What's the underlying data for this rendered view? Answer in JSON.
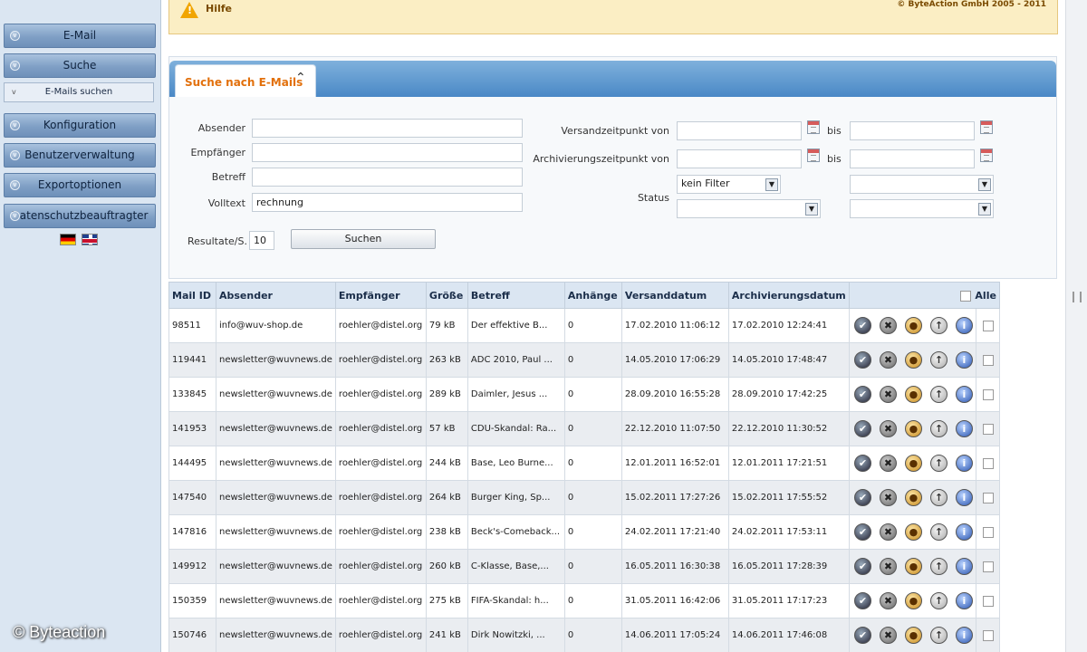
{
  "sidebar": {
    "items": [
      {
        "label": "E-Mail"
      },
      {
        "label": "Suche"
      },
      {
        "label": "Konfiguration"
      },
      {
        "label": "Benutzerverwaltung"
      },
      {
        "label": "Exportoptionen"
      },
      {
        "label": "Datenschutzbeauftragter"
      }
    ],
    "sub_item": {
      "label": "E-Mails suchen"
    }
  },
  "watermark": "© Byteaction",
  "helpbar": {
    "label": "Hilfe",
    "copyright": "© ByteAction GmbH 2005 - 2011"
  },
  "search": {
    "tab_label": "Suche nach E-Mails",
    "fields": {
      "absender_label": "Absender",
      "empfaenger_label": "Empfänger",
      "betreff_label": "Betreff",
      "volltext_label": "Volltext",
      "volltext_value": "rechnung",
      "versandzeitpunkt_label": "Versandzeitpunkt von",
      "archivierungszeitpunkt_label": "Archivierungszeitpunkt von",
      "bis_label": "bis",
      "status_label": "Status",
      "status_value": "kein Filter",
      "results_per_page_label": "Resultate/S.",
      "results_per_page_value": "10"
    },
    "button_label": "Suchen"
  },
  "table": {
    "headers": [
      "Mail ID",
      "Absender",
      "Empfänger",
      "Größe",
      "Betreff",
      "Anhänge",
      "Versanddatum",
      "Archivierungsdatum",
      "Alle"
    ],
    "rows": [
      {
        "id": "98511",
        "from": "info@wuv-shop.de",
        "to": "roehler@distel.org",
        "size": "79 kB",
        "subject": "Der effektive B...",
        "attach": "0",
        "sent": "17.02.2010 11:06:12",
        "archived": "17.02.2010 12:24:41"
      },
      {
        "id": "119441",
        "from": "newsletter@wuvnews.de",
        "to": "roehler@distel.org",
        "size": "263 kB",
        "subject": "ADC 2010, Paul ...",
        "attach": "0",
        "sent": "14.05.2010 17:06:29",
        "archived": "14.05.2010 17:48:47"
      },
      {
        "id": "133845",
        "from": "newsletter@wuvnews.de",
        "to": "roehler@distel.org",
        "size": "289 kB",
        "subject": "Daimler, Jesus ...",
        "attach": "0",
        "sent": "28.09.2010 16:55:28",
        "archived": "28.09.2010 17:42:25"
      },
      {
        "id": "141953",
        "from": "newsletter@wuvnews.de",
        "to": "roehler@distel.org",
        "size": "57 kB",
        "subject": "CDU-Skandal: Ra...",
        "attach": "0",
        "sent": "22.12.2010 11:07:50",
        "archived": "22.12.2010 11:30:52"
      },
      {
        "id": "144495",
        "from": "newsletter@wuvnews.de",
        "to": "roehler@distel.org",
        "size": "244 kB",
        "subject": "Base, Leo Burne...",
        "attach": "0",
        "sent": "12.01.2011 16:52:01",
        "archived": "12.01.2011 17:21:51"
      },
      {
        "id": "147540",
        "from": "newsletter@wuvnews.de",
        "to": "roehler@distel.org",
        "size": "264 kB",
        "subject": "Burger King, Sp...",
        "attach": "0",
        "sent": "15.02.2011 17:27:26",
        "archived": "15.02.2011 17:55:52"
      },
      {
        "id": "147816",
        "from": "newsletter@wuvnews.de",
        "to": "roehler@distel.org",
        "size": "238 kB",
        "subject": "Beck's-Comeback...",
        "attach": "0",
        "sent": "24.02.2011 17:21:40",
        "archived": "24.02.2011 17:53:11"
      },
      {
        "id": "149912",
        "from": "newsletter@wuvnews.de",
        "to": "roehler@distel.org",
        "size": "260 kB",
        "subject": "C-Klasse, Base,...",
        "attach": "0",
        "sent": "16.05.2011 16:30:38",
        "archived": "16.05.2011 17:28:39"
      },
      {
        "id": "150359",
        "from": "newsletter@wuvnews.de",
        "to": "roehler@distel.org",
        "size": "275 kB",
        "subject": "FIFA-Skandal: h...",
        "attach": "0",
        "sent": "31.05.2011 16:42:06",
        "archived": "31.05.2011 17:17:23"
      },
      {
        "id": "150746",
        "from": "newsletter@wuvnews.de",
        "to": "roehler@distel.org",
        "size": "241 kB",
        "subject": "Dirk Nowitzki, ...",
        "attach": "0",
        "sent": "14.06.2011 17:05:24",
        "archived": "14.06.2011 17:46:08"
      }
    ],
    "action_icons": [
      "check-icon",
      "delete-icon",
      "restore-icon",
      "forward-icon",
      "info-icon"
    ]
  },
  "colors": {
    "accent_orange": "#e2700c",
    "nav_blue": "#7f9fc5",
    "help_bg": "#fbeec4",
    "header_bg": "#dbe6f2"
  }
}
